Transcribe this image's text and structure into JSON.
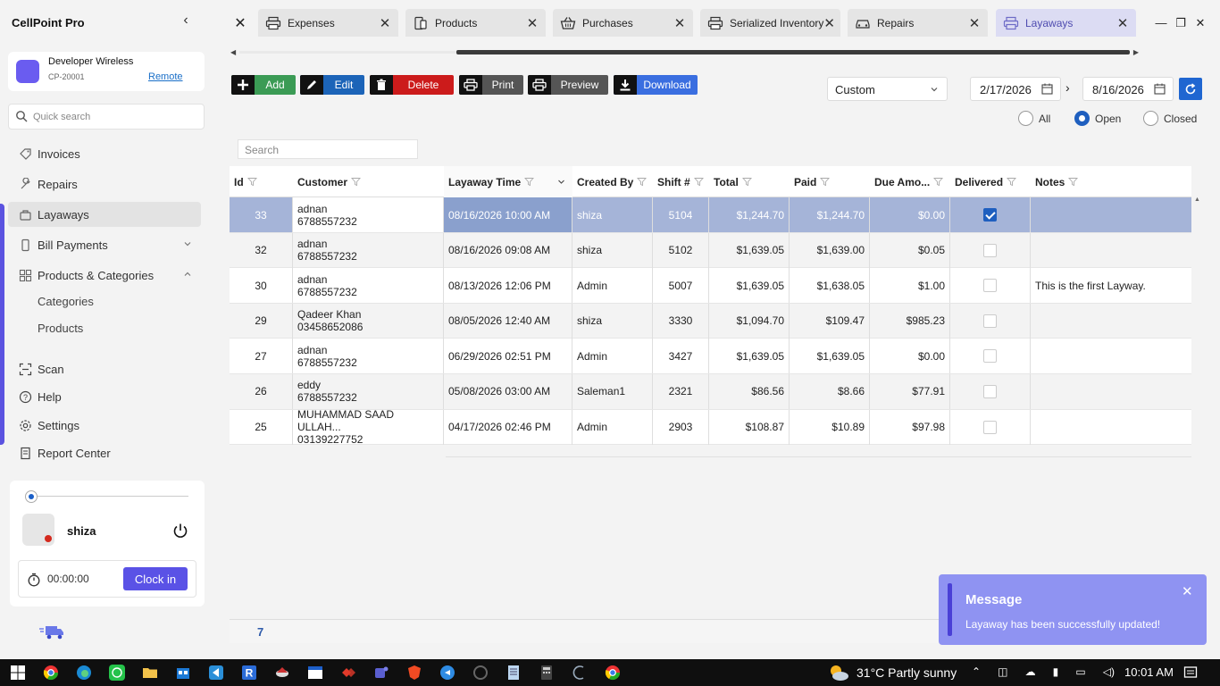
{
  "app": {
    "title": "CellPoint Pro",
    "collapse_glyph": "‹"
  },
  "store": {
    "name": "Developer Wireless",
    "id": "CP-20001",
    "mode": "Remote"
  },
  "quick_search": {
    "placeholder": "Quick search"
  },
  "nav": {
    "invoices": "Invoices",
    "repairs": "Repairs",
    "layaways": "Layaways",
    "bill_payments": "Bill Payments",
    "products_categories": "Products & Categories",
    "categories": "Categories",
    "products": "Products",
    "scan": "Scan",
    "help": "Help",
    "settings": "Settings",
    "report_center": "Report Center"
  },
  "user": {
    "name": "shiza",
    "timer": "00:00:00",
    "clock_in_label": "Clock in"
  },
  "tabs": [
    {
      "label": "Expenses",
      "icon": "printer-icon"
    },
    {
      "label": "Products",
      "icon": "phone-icon"
    },
    {
      "label": "Purchases",
      "icon": "basket-icon"
    },
    {
      "label": "Serialized Inventory",
      "icon": "printer-icon"
    },
    {
      "label": "Repairs",
      "icon": "car-icon"
    },
    {
      "label": "Layaways",
      "icon": "printer-icon",
      "active": true
    }
  ],
  "toolbar": {
    "add": "Add",
    "edit": "Edit",
    "delete": "Delete",
    "print": "Print",
    "preview": "Preview",
    "download": "Download"
  },
  "filters": {
    "range": "Custom",
    "date_from": "2/17/2026",
    "date_to": "8/16/2026",
    "status_options": [
      "All",
      "Open",
      "Closed"
    ],
    "status_selected": "Open"
  },
  "grid": {
    "search_placeholder": "Search",
    "columns": [
      "Id",
      "Customer",
      "Layaway Time",
      "Created By",
      "Shift #",
      "Total",
      "Paid",
      "Due Amo...",
      "Delivered",
      "Notes"
    ],
    "rows": [
      {
        "id": "33",
        "customer": "adnan",
        "phone": "6788557232",
        "time": "08/16/2026 10:00 AM",
        "created_by": "shiza",
        "shift": "5104",
        "total": "$1,244.70",
        "paid": "$1,244.70",
        "due": "$0.00",
        "delivered": true,
        "notes": "",
        "selected": true
      },
      {
        "id": "32",
        "customer": "adnan",
        "phone": "6788557232",
        "time": "08/16/2026 09:08 AM",
        "created_by": "shiza",
        "shift": "5102",
        "total": "$1,639.05",
        "paid": "$1,639.00",
        "due": "$0.05",
        "delivered": false,
        "notes": ""
      },
      {
        "id": "30",
        "customer": "adnan",
        "phone": "6788557232",
        "time": "08/13/2026 12:06 PM",
        "created_by": "Admin",
        "shift": "5007",
        "total": "$1,639.05",
        "paid": "$1,638.05",
        "due": "$1.00",
        "delivered": false,
        "notes": "This is the first Layway."
      },
      {
        "id": "29",
        "customer": "Qadeer Khan",
        "phone": "03458652086",
        "time": "08/05/2026 12:40 AM",
        "created_by": "shiza",
        "shift": "3330",
        "total": "$1,094.70",
        "paid": "$109.47",
        "due": "$985.23",
        "delivered": false,
        "notes": ""
      },
      {
        "id": "27",
        "customer": "adnan",
        "phone": "6788557232",
        "time": "06/29/2026 02:51 PM",
        "created_by": "Admin",
        "shift": "3427",
        "total": "$1,639.05",
        "paid": "$1,639.05",
        "due": "$0.00",
        "delivered": false,
        "notes": ""
      },
      {
        "id": "26",
        "customer": "eddy",
        "phone": "6788557232",
        "time": "05/08/2026 03:00 AM",
        "created_by": "Saleman1",
        "shift": "2321",
        "total": "$86.56",
        "paid": "$8.66",
        "due": "$77.91",
        "delivered": false,
        "notes": ""
      },
      {
        "id": "25",
        "customer": "MUHAMMAD SAAD ULLAH...",
        "phone": "03139227752",
        "time": "04/17/2026 02:46 PM",
        "created_by": "Admin",
        "shift": "2903",
        "total": "$108.87",
        "paid": "$10.89",
        "due": "$97.98",
        "delivered": false,
        "notes": ""
      }
    ],
    "count": "7"
  },
  "toast": {
    "title": "Message",
    "message": "Layaway has been successfully updated!"
  },
  "taskbar": {
    "weather": "31°C  Partly sunny",
    "time": "10:01 AM"
  },
  "colors": {
    "accent": "#5a52e6",
    "selected_row": "#a5b4d8",
    "toast": "#8f93f2"
  }
}
